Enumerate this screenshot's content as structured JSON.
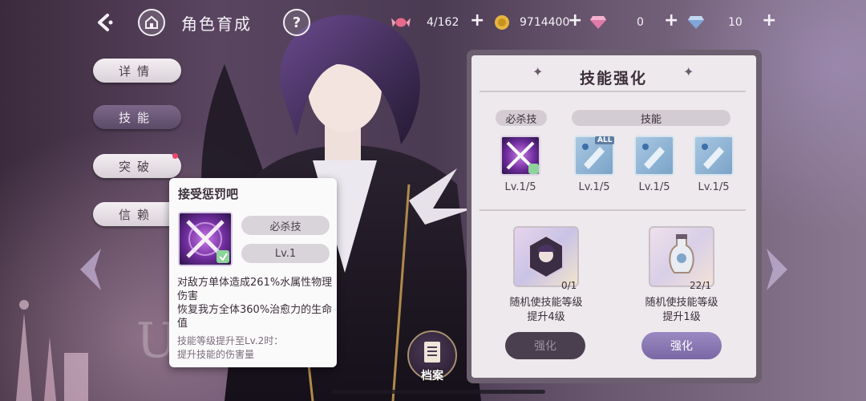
{
  "header": {
    "title": "角色育成",
    "help_label": "?",
    "currencies": [
      {
        "icon": "candy-icon",
        "value": "4/162"
      },
      {
        "icon": "gold-coin-icon",
        "value": "9714400"
      },
      {
        "icon": "pink-diamond-icon",
        "value": "0"
      },
      {
        "icon": "blue-diamond-icon",
        "value": "10"
      }
    ],
    "plus_label": "+"
  },
  "nav": {
    "items": [
      {
        "label": "详情",
        "active": false
      },
      {
        "label": "技能",
        "active": true
      },
      {
        "label": "突破",
        "active": false
      },
      {
        "label": "信赖",
        "active": false
      }
    ]
  },
  "popup": {
    "title": "接受惩罚吧",
    "type_tag": "必杀技",
    "level_tag": "Lv.1",
    "description": "对敌方单体造成261%水属性物理伤害\n恢复我方全体360%治愈力的生命值",
    "next_level": "技能等级提升至Lv.2时：\n提升技能的伤害量"
  },
  "archive": {
    "label": "档案"
  },
  "panel": {
    "title": "技能强化",
    "ultimate_section": "必杀技",
    "skill_section": "技能",
    "skills": [
      {
        "kind": "ultimate",
        "level": "Lv.1/5"
      },
      {
        "kind": "normal",
        "level": "Lv.1/5",
        "badge": "ALL"
      },
      {
        "kind": "normal",
        "level": "Lv.1/5"
      },
      {
        "kind": "normal",
        "level": "Lv.1/5"
      }
    ],
    "items": [
      {
        "count": "0/1",
        "text": "随机使技能等级\n提升4级",
        "button": "强化",
        "enabled": false
      },
      {
        "count": "22/1",
        "text": "随机使技能等级\n提升1级",
        "button": "强化",
        "enabled": true
      }
    ]
  }
}
